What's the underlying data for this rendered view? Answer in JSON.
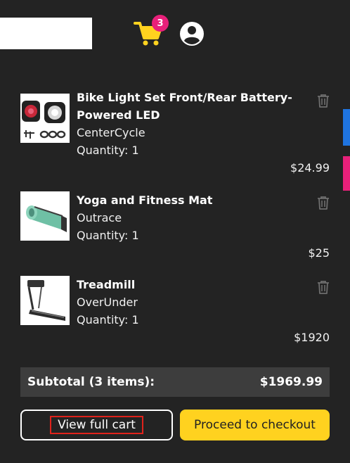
{
  "header": {
    "cart_count": "3",
    "accent_color": "#ffd21f",
    "badge_color": "#e8207a"
  },
  "cart": {
    "items": [
      {
        "title": "Bike Light Set Front/Rear Battery-Powered LED",
        "brand": "CenterCycle",
        "quantity": "Quantity: 1",
        "price": "$24.99",
        "thumb": "bike-lights"
      },
      {
        "title": "Yoga and Fitness Mat",
        "brand": "Outrace",
        "quantity": "Quantity: 1",
        "price": "$25",
        "thumb": "yoga-mat"
      },
      {
        "title": "Treadmill",
        "brand": "OverUnder",
        "quantity": "Quantity: 1",
        "price": "$1920",
        "thumb": "treadmill"
      }
    ],
    "subtotal_label": "Subtotal (3 items):",
    "subtotal_value": "$1969.99"
  },
  "actions": {
    "view_cart_label": "View full cart",
    "checkout_label": "Proceed to checkout"
  }
}
